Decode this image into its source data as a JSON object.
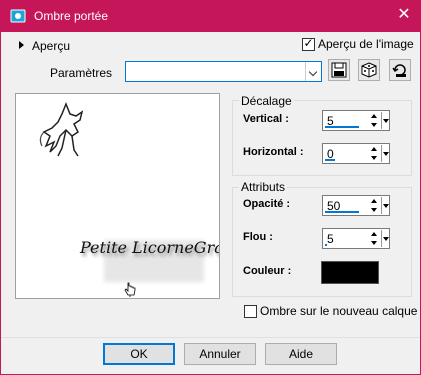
{
  "window": {
    "title": "Ombre portée",
    "close_glyph": "✕"
  },
  "top": {
    "apercu_label": "Aperçu",
    "apercu_image_label": "Aperçu de l'image",
    "apercu_image_checked": true,
    "parametres_label": "Paramètres",
    "parametres_value": ""
  },
  "preview": {
    "watermark_text": "Petite LicorneGraphisme"
  },
  "decalage": {
    "title": "Décalage",
    "vertical_label": "Vertical :",
    "vertical_value": "5",
    "horizontal_label": "Horizontal :",
    "horizontal_value": "0"
  },
  "attributs": {
    "title": "Attributs",
    "opacite_label": "Opacité :",
    "opacite_value": "50",
    "flou_label": "Flou :",
    "flou_value": "5",
    "couleur_label": "Couleur :",
    "couleur_value": "#000000"
  },
  "ombre_nouveau_calque": {
    "label": "Ombre sur le nouveau calque",
    "checked": false
  },
  "buttons": {
    "ok": "OK",
    "annuler": "Annuler",
    "aide": "Aide"
  },
  "colors": {
    "titlebar": "#c6165a",
    "accent": "#0078d7"
  }
}
